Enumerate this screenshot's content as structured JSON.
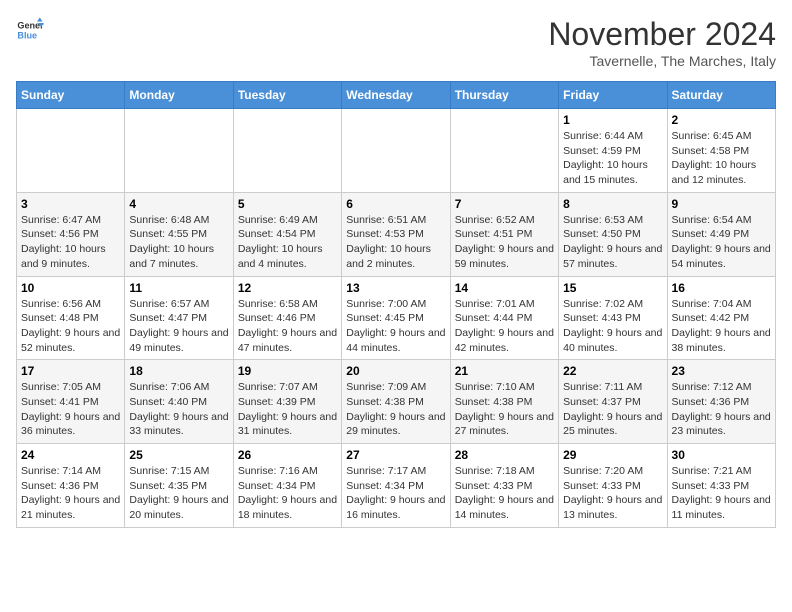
{
  "logo": {
    "line1": "General",
    "line2": "Blue"
  },
  "title": "November 2024",
  "subtitle": "Tavernelle, The Marches, Italy",
  "days_of_week": [
    "Sunday",
    "Monday",
    "Tuesday",
    "Wednesday",
    "Thursday",
    "Friday",
    "Saturday"
  ],
  "weeks": [
    [
      {
        "day": "",
        "info": ""
      },
      {
        "day": "",
        "info": ""
      },
      {
        "day": "",
        "info": ""
      },
      {
        "day": "",
        "info": ""
      },
      {
        "day": "",
        "info": ""
      },
      {
        "day": "1",
        "info": "Sunrise: 6:44 AM\nSunset: 4:59 PM\nDaylight: 10 hours and 15 minutes."
      },
      {
        "day": "2",
        "info": "Sunrise: 6:45 AM\nSunset: 4:58 PM\nDaylight: 10 hours and 12 minutes."
      }
    ],
    [
      {
        "day": "3",
        "info": "Sunrise: 6:47 AM\nSunset: 4:56 PM\nDaylight: 10 hours and 9 minutes."
      },
      {
        "day": "4",
        "info": "Sunrise: 6:48 AM\nSunset: 4:55 PM\nDaylight: 10 hours and 7 minutes."
      },
      {
        "day": "5",
        "info": "Sunrise: 6:49 AM\nSunset: 4:54 PM\nDaylight: 10 hours and 4 minutes."
      },
      {
        "day": "6",
        "info": "Sunrise: 6:51 AM\nSunset: 4:53 PM\nDaylight: 10 hours and 2 minutes."
      },
      {
        "day": "7",
        "info": "Sunrise: 6:52 AM\nSunset: 4:51 PM\nDaylight: 9 hours and 59 minutes."
      },
      {
        "day": "8",
        "info": "Sunrise: 6:53 AM\nSunset: 4:50 PM\nDaylight: 9 hours and 57 minutes."
      },
      {
        "day": "9",
        "info": "Sunrise: 6:54 AM\nSunset: 4:49 PM\nDaylight: 9 hours and 54 minutes."
      }
    ],
    [
      {
        "day": "10",
        "info": "Sunrise: 6:56 AM\nSunset: 4:48 PM\nDaylight: 9 hours and 52 minutes."
      },
      {
        "day": "11",
        "info": "Sunrise: 6:57 AM\nSunset: 4:47 PM\nDaylight: 9 hours and 49 minutes."
      },
      {
        "day": "12",
        "info": "Sunrise: 6:58 AM\nSunset: 4:46 PM\nDaylight: 9 hours and 47 minutes."
      },
      {
        "day": "13",
        "info": "Sunrise: 7:00 AM\nSunset: 4:45 PM\nDaylight: 9 hours and 44 minutes."
      },
      {
        "day": "14",
        "info": "Sunrise: 7:01 AM\nSunset: 4:44 PM\nDaylight: 9 hours and 42 minutes."
      },
      {
        "day": "15",
        "info": "Sunrise: 7:02 AM\nSunset: 4:43 PM\nDaylight: 9 hours and 40 minutes."
      },
      {
        "day": "16",
        "info": "Sunrise: 7:04 AM\nSunset: 4:42 PM\nDaylight: 9 hours and 38 minutes."
      }
    ],
    [
      {
        "day": "17",
        "info": "Sunrise: 7:05 AM\nSunset: 4:41 PM\nDaylight: 9 hours and 36 minutes."
      },
      {
        "day": "18",
        "info": "Sunrise: 7:06 AM\nSunset: 4:40 PM\nDaylight: 9 hours and 33 minutes."
      },
      {
        "day": "19",
        "info": "Sunrise: 7:07 AM\nSunset: 4:39 PM\nDaylight: 9 hours and 31 minutes."
      },
      {
        "day": "20",
        "info": "Sunrise: 7:09 AM\nSunset: 4:38 PM\nDaylight: 9 hours and 29 minutes."
      },
      {
        "day": "21",
        "info": "Sunrise: 7:10 AM\nSunset: 4:38 PM\nDaylight: 9 hours and 27 minutes."
      },
      {
        "day": "22",
        "info": "Sunrise: 7:11 AM\nSunset: 4:37 PM\nDaylight: 9 hours and 25 minutes."
      },
      {
        "day": "23",
        "info": "Sunrise: 7:12 AM\nSunset: 4:36 PM\nDaylight: 9 hours and 23 minutes."
      }
    ],
    [
      {
        "day": "24",
        "info": "Sunrise: 7:14 AM\nSunset: 4:36 PM\nDaylight: 9 hours and 21 minutes."
      },
      {
        "day": "25",
        "info": "Sunrise: 7:15 AM\nSunset: 4:35 PM\nDaylight: 9 hours and 20 minutes."
      },
      {
        "day": "26",
        "info": "Sunrise: 7:16 AM\nSunset: 4:34 PM\nDaylight: 9 hours and 18 minutes."
      },
      {
        "day": "27",
        "info": "Sunrise: 7:17 AM\nSunset: 4:34 PM\nDaylight: 9 hours and 16 minutes."
      },
      {
        "day": "28",
        "info": "Sunrise: 7:18 AM\nSunset: 4:33 PM\nDaylight: 9 hours and 14 minutes."
      },
      {
        "day": "29",
        "info": "Sunrise: 7:20 AM\nSunset: 4:33 PM\nDaylight: 9 hours and 13 minutes."
      },
      {
        "day": "30",
        "info": "Sunrise: 7:21 AM\nSunset: 4:33 PM\nDaylight: 9 hours and 11 minutes."
      }
    ]
  ]
}
